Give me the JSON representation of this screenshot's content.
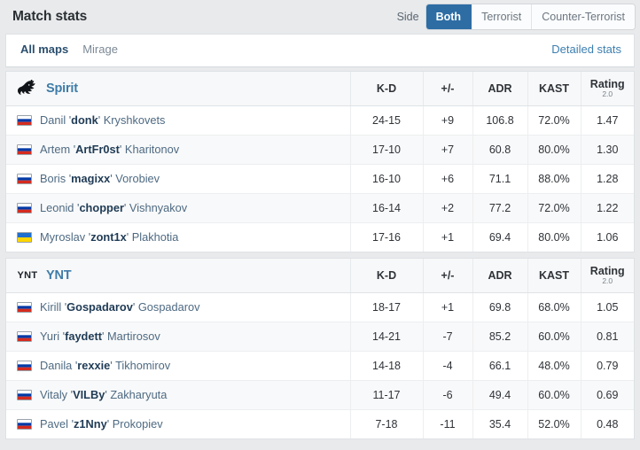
{
  "header": {
    "title": "Match stats",
    "side_label": "Side",
    "side_options": [
      {
        "label": "Both",
        "active": true
      },
      {
        "label": "Terrorist",
        "active": false
      },
      {
        "label": "Counter-Terrorist",
        "active": false
      }
    ]
  },
  "maps_bar": {
    "tabs": [
      {
        "label": "All maps",
        "active": true
      },
      {
        "label": "Mirage",
        "active": false
      }
    ],
    "detailed_stats": "Detailed stats"
  },
  "columns": {
    "kd": "K-D",
    "plusminus": "+/-",
    "adr": "ADR",
    "kast": "KAST",
    "rating_main": "Rating",
    "rating_sub": "2.0"
  },
  "colors": {
    "accent_blue": "#2d6da4",
    "team_link": "#3d7ca8",
    "positive_green": "#4b9d4b",
    "negative_red": "#c0405a",
    "page_background": "#e8eaec"
  },
  "teams": [
    {
      "name": "Spirit",
      "logo": "spirit-dragon-icon",
      "players": [
        {
          "flag": "ru",
          "first": "Danil",
          "nick": "donk",
          "last": "Kryshkovets",
          "kd": "24-15",
          "pm": "+9",
          "pm_sign": "pos",
          "adr": "106.8",
          "kast": "72.0%",
          "rating": "1.47"
        },
        {
          "flag": "ru",
          "first": "Artem",
          "nick": "ArtFr0st",
          "last": "Kharitonov",
          "kd": "17-10",
          "pm": "+7",
          "pm_sign": "pos",
          "adr": "60.8",
          "kast": "80.0%",
          "rating": "1.30"
        },
        {
          "flag": "ru",
          "first": "Boris",
          "nick": "magixx",
          "last": "Vorobiev",
          "kd": "16-10",
          "pm": "+6",
          "pm_sign": "pos",
          "adr": "71.1",
          "kast": "88.0%",
          "rating": "1.28"
        },
        {
          "flag": "ru",
          "first": "Leonid",
          "nick": "chopper",
          "last": "Vishnyakov",
          "kd": "16-14",
          "pm": "+2",
          "pm_sign": "pos",
          "adr": "77.2",
          "kast": "72.0%",
          "rating": "1.22"
        },
        {
          "flag": "ua",
          "first": "Myroslav",
          "nick": "zont1x",
          "last": "Plakhotia",
          "kd": "17-16",
          "pm": "+1",
          "pm_sign": "pos",
          "adr": "69.4",
          "kast": "80.0%",
          "rating": "1.06"
        }
      ]
    },
    {
      "name": "YNT",
      "logo": "ynt-text-icon",
      "logo_text": "YNT",
      "players": [
        {
          "flag": "ru",
          "first": "Kirill",
          "nick": "Gospadarov",
          "last": "Gospadarov",
          "kd": "18-17",
          "pm": "+1",
          "pm_sign": "pos",
          "adr": "69.8",
          "kast": "68.0%",
          "rating": "1.05"
        },
        {
          "flag": "ru",
          "first": "Yuri",
          "nick": "faydett",
          "last": "Martirosov",
          "kd": "14-21",
          "pm": "-7",
          "pm_sign": "neg",
          "adr": "85.2",
          "kast": "60.0%",
          "rating": "0.81"
        },
        {
          "flag": "ru",
          "first": "Danila",
          "nick": "rexxie",
          "last": "Tikhomirov",
          "kd": "14-18",
          "pm": "-4",
          "pm_sign": "neg",
          "adr": "66.1",
          "kast": "48.0%",
          "rating": "0.79"
        },
        {
          "flag": "ru",
          "first": "Vitaly",
          "nick": "VILBy",
          "last": "Zakharyuta",
          "kd": "11-17",
          "pm": "-6",
          "pm_sign": "neg",
          "adr": "49.4",
          "kast": "60.0%",
          "rating": "0.69"
        },
        {
          "flag": "ru",
          "first": "Pavel",
          "nick": "z1Nny",
          "last": "Prokopiev",
          "kd": "7-18",
          "pm": "-11",
          "pm_sign": "neg",
          "adr": "35.4",
          "kast": "52.0%",
          "rating": "0.48"
        }
      ]
    }
  ]
}
